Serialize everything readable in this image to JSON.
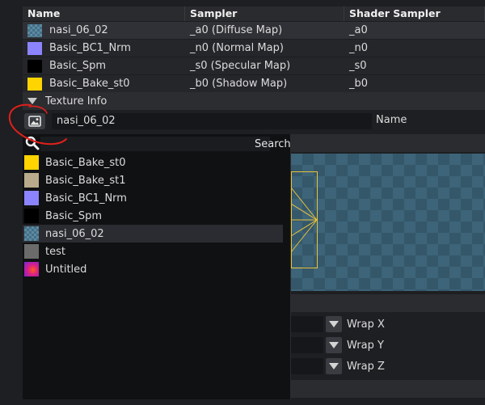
{
  "table": {
    "headers": [
      "Name",
      "Sampler",
      "Shader Sampler"
    ],
    "rows": [
      {
        "name": "nasi_06_02",
        "sampler": "_a0 (Diffuse Map)",
        "shader": "_a0",
        "swatch": "checker"
      },
      {
        "name": "Basic_BC1_Nrm",
        "sampler": "_n0 (Normal Map)",
        "shader": "_n0",
        "swatch": "#8c84ff"
      },
      {
        "name": "Basic_Spm",
        "sampler": "_s0 (Specular Map)",
        "shader": "_s0",
        "swatch": "#000000"
      },
      {
        "name": "Basic_Bake_st0",
        "sampler": "_b0 (Shadow Map)",
        "shader": "_b0",
        "swatch": "#ffd400"
      }
    ]
  },
  "texture_info": {
    "header": "Texture Info",
    "name_value": "nasi_06_02",
    "name_label": "Name",
    "picker_icon": "image-icon"
  },
  "popup": {
    "search_label": "Search",
    "items": [
      {
        "label": "Basic_Bake_st0",
        "swatch": "#ffd400"
      },
      {
        "label": "Basic_Bake_st1",
        "swatch": "#b9aa8c"
      },
      {
        "label": "Basic_BC1_Nrm",
        "swatch": "#8c84ff"
      },
      {
        "label": "Basic_Spm",
        "swatch": "#000000"
      },
      {
        "label": "nasi_06_02",
        "swatch": "checker",
        "selected": true
      },
      {
        "label": "test",
        "swatch": "#6b6b6b"
      },
      {
        "label": "Untitled",
        "swatch": "gradient"
      }
    ]
  },
  "wrap": {
    "x_label": "Wrap X",
    "y_label": "Wrap Y",
    "z_label": "Wrap Z"
  },
  "colors": {
    "uv_highlight": "#e8c23a",
    "annotation_red": "#e0201c"
  }
}
